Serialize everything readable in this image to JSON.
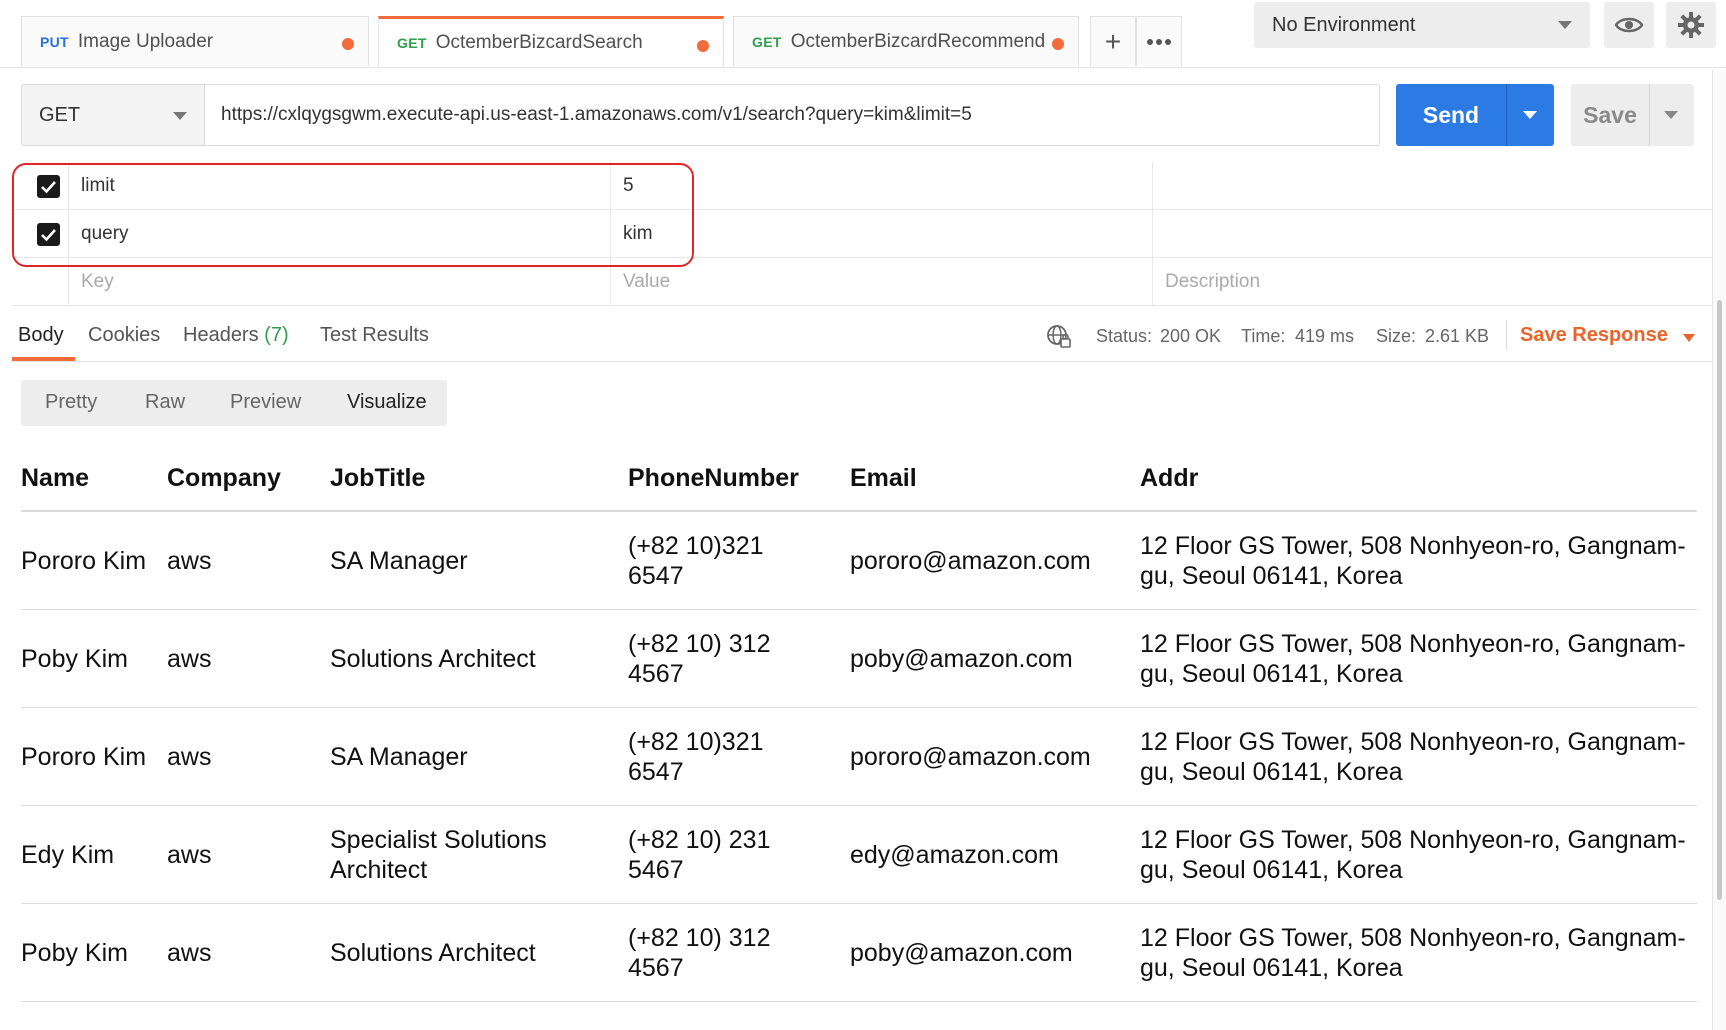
{
  "tabs": [
    {
      "method": "PUT",
      "title": "Image Uploader",
      "modified": true
    },
    {
      "method": "GET",
      "title": "OctemberBizcardSearch",
      "modified": true,
      "active": true
    },
    {
      "method": "GET",
      "title": "OctemberBizcardRecommend",
      "modified": true
    }
  ],
  "environment": {
    "selected": "No Environment"
  },
  "request": {
    "method": "GET",
    "url": "https://cxlqygsgwm.execute-api.us-east-1.amazonaws.com/v1/search?query=kim&limit=5",
    "send_label": "Send",
    "save_label": "Save"
  },
  "params": {
    "rows": [
      {
        "checked": true,
        "key": "limit",
        "value": "5",
        "description": ""
      },
      {
        "checked": true,
        "key": "query",
        "value": "kim",
        "description": ""
      }
    ],
    "placeholder": {
      "key": "Key",
      "value": "Value",
      "description": "Description"
    }
  },
  "response": {
    "tabs": [
      "Body",
      "Cookies",
      "Headers",
      "Test Results"
    ],
    "headers_count": "(7)",
    "status_label": "Status:",
    "status": "200 OK",
    "time_label": "Time:",
    "time": "419 ms",
    "size_label": "Size:",
    "size": "2.61 KB",
    "save_response": "Save Response",
    "view_modes": [
      "Pretty",
      "Raw",
      "Preview",
      "Visualize"
    ],
    "active_view": "Visualize"
  },
  "visualize": {
    "columns": [
      "Name",
      "Company",
      "JobTitle",
      "PhoneNumber",
      "Email",
      "Addr"
    ],
    "rows": [
      [
        "Pororo Kim",
        "aws",
        "SA Manager",
        "(+82 10)321 6547",
        "pororo@amazon.com",
        "12 Floor GS Tower, 508 Nonhyeon-ro, Gangnam-gu, Seoul 06141, Korea"
      ],
      [
        "Poby Kim",
        "aws",
        "Solutions Architect",
        "(+82 10) 312 4567",
        "poby@amazon.com",
        "12 Floor GS Tower, 508 Nonhyeon-ro, Gangnam-gu, Seoul 06141, Korea"
      ],
      [
        "Pororo Kim",
        "aws",
        "SA Manager",
        "(+82 10)321 6547",
        "pororo@amazon.com",
        "12 Floor GS Tower, 508 Nonhyeon-ro, Gangnam-gu, Seoul 06141, Korea"
      ],
      [
        "Edy Kim",
        "aws",
        "Specialist Solutions Architect",
        "(+82 10) 231 5467",
        "edy@amazon.com",
        "12 Floor GS Tower, 508 Nonhyeon-ro, Gangnam-gu, Seoul 06141, Korea"
      ],
      [
        "Poby Kim",
        "aws",
        "Solutions Architect",
        "(+82 10) 312 4567",
        "poby@amazon.com",
        "12 Floor GS Tower, 508 Nonhyeon-ro, Gangnam-gu, Seoul 06141, Korea"
      ]
    ]
  },
  "colors": {
    "accent": "#f26b3a",
    "send": "#2c7be5",
    "status_ok": "#2f9e4f",
    "highlight": "#e0262b"
  }
}
